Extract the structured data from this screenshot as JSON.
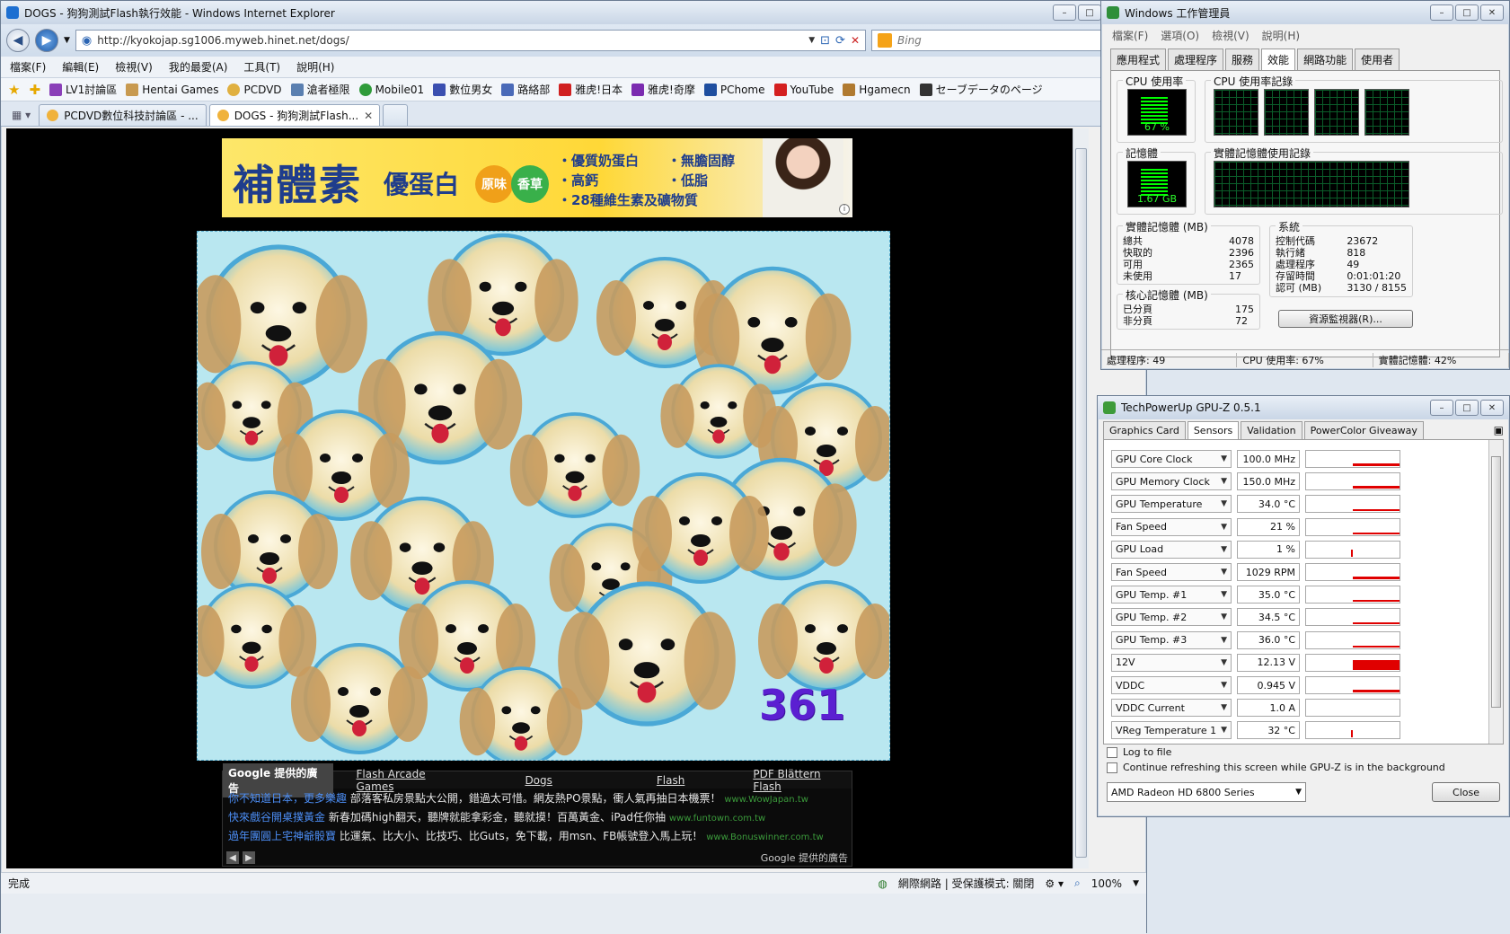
{
  "ie": {
    "title": "DOGS - 狗狗測試Flash執行效能 - Windows Internet Explorer",
    "address": "http://kyokojap.sg1006.myweb.hinet.net/dogs/",
    "search_placeholder": "Bing",
    "menu": [
      "檔案(F)",
      "編輯(E)",
      "檢視(V)",
      "我的最愛(A)",
      "工具(T)",
      "說明(H)"
    ],
    "favorites": [
      "LV1討論區",
      "Hentai Games",
      "PCDVD",
      "滄者極限",
      "Mobile01",
      "數位男女",
      "路絡部",
      "雅虎!日本",
      "雅虎!奇摩",
      "PChome",
      "YouTube",
      "Hgamecn",
      "セーブデータのページ"
    ],
    "tabs": [
      {
        "label": "PCDVD數位科技討論區 - ..."
      },
      {
        "label": "DOGS - 狗狗測試Flash..."
      }
    ],
    "status_left": "完成",
    "status_zone": "網際網路 | 受保護模式: 關閉",
    "zoom": "100%"
  },
  "banner": {
    "title": "補體素",
    "subtitle": "優蛋白",
    "pill1": "原味",
    "pill2": "香草",
    "features": [
      "・優質奶蛋白",
      "・高鈣",
      "・28種維生素及礦物質",
      "・無膽固醇",
      "・低脂"
    ]
  },
  "game": {
    "counter": "361"
  },
  "google_ads": {
    "label": "Google 提供的廣告",
    "links": [
      "Flash Arcade Games",
      "Dogs",
      "Flash",
      "PDF Blättern Flash"
    ],
    "ads": [
      {
        "title": "你不知道日本，更多樂趣",
        "body": "部落客私房景點大公開，錯過太可惜。網友熱PO景點，衝人氣再抽日本機票！",
        "url": "www.WowJapan.tw"
      },
      {
        "title": "快來戲谷開桌撲黃金",
        "body": "新春加碼high翻天，聽牌就能拿彩金，聽就摸！百萬黃金、iPad任你抽",
        "url": "www.funtown.com.tw"
      },
      {
        "title": "過年團圓上宅神爺骰寶",
        "body": "比運氣、比大小、比技巧、比Guts，免下載，用msn、FB帳號登入馬上玩！",
        "url": "www.Bonuswinner.com.tw"
      }
    ],
    "footer": "Google 提供的廣告"
  },
  "taskmanager": {
    "title": "Windows 工作管理員",
    "menu": [
      "檔案(F)",
      "選項(O)",
      "檢視(V)",
      "說明(H)"
    ],
    "tabs": [
      "應用程式",
      "處理程序",
      "服務",
      "效能",
      "網路功能",
      "使用者"
    ],
    "cpu_usage_label": "CPU 使用率",
    "cpu_history_label": "CPU 使用率記錄",
    "cpu_value": "67 %",
    "mem_label": "記憶體",
    "mem_history_label": "實體記憶體使用記錄",
    "mem_value": "1.67 GB",
    "physical": {
      "title": "實體記憶體 (MB)",
      "rows": [
        [
          "總共",
          "4078"
        ],
        [
          "快取的",
          "2396"
        ],
        [
          "可用",
          "2365"
        ],
        [
          "未使用",
          "17"
        ]
      ]
    },
    "system": {
      "title": "系統",
      "rows": [
        [
          "控制代碼",
          "23672"
        ],
        [
          "執行緒",
          "818"
        ],
        [
          "處理程序",
          "49"
        ],
        [
          "存留時間",
          "0:01:01:20"
        ],
        [
          "認可 (MB)",
          "3130 / 8155"
        ]
      ]
    },
    "kernel": {
      "title": "核心記憶體 (MB)",
      "rows": [
        [
          "已分頁",
          "175"
        ],
        [
          "非分頁",
          "72"
        ]
      ]
    },
    "resource_button": "資源監視器(R)...",
    "status": [
      "處理程序: 49",
      "CPU 使用率: 67%",
      "實體記憶體: 42%"
    ]
  },
  "gpuz": {
    "title": "TechPowerUp GPU-Z 0.5.1",
    "tabs": [
      "Graphics Card",
      "Sensors",
      "Validation",
      "PowerColor Giveaway"
    ],
    "sensors": [
      {
        "label": "GPU Core Clock",
        "value": "100.0 MHz",
        "level": 0.15
      },
      {
        "label": "GPU Memory Clock",
        "value": "150.0 MHz",
        "level": 0.15
      },
      {
        "label": "GPU Temperature",
        "value": "34.0 °C",
        "level": 0.1
      },
      {
        "label": "Fan Speed",
        "value": "21 %",
        "level": 0.1
      },
      {
        "label": "GPU Load",
        "value": "1 %",
        "level": 0.05
      },
      {
        "label": "Fan Speed",
        "value": "1029 RPM",
        "level": 0.2
      },
      {
        "label": "GPU Temp. #1",
        "value": "35.0 °C",
        "level": 0.1
      },
      {
        "label": "GPU Temp. #2",
        "value": "34.5 °C",
        "level": 0.1
      },
      {
        "label": "GPU Temp. #3",
        "value": "36.0 °C",
        "level": 0.1
      },
      {
        "label": "12V",
        "value": "12.13 V",
        "level": 0.6
      },
      {
        "label": "VDDC",
        "value": "0.945 V",
        "level": 0.2
      },
      {
        "label": "VDDC Current",
        "value": "1.0 A",
        "level": 0.0
      },
      {
        "label": "VReg Temperature 1",
        "value": "32 °C",
        "level": 0.05
      }
    ],
    "log_to_file": "Log to file",
    "continue_refresh": "Continue refreshing this screen while GPU-Z is in the background",
    "card": "AMD Radeon HD 6800 Series",
    "close": "Close"
  }
}
